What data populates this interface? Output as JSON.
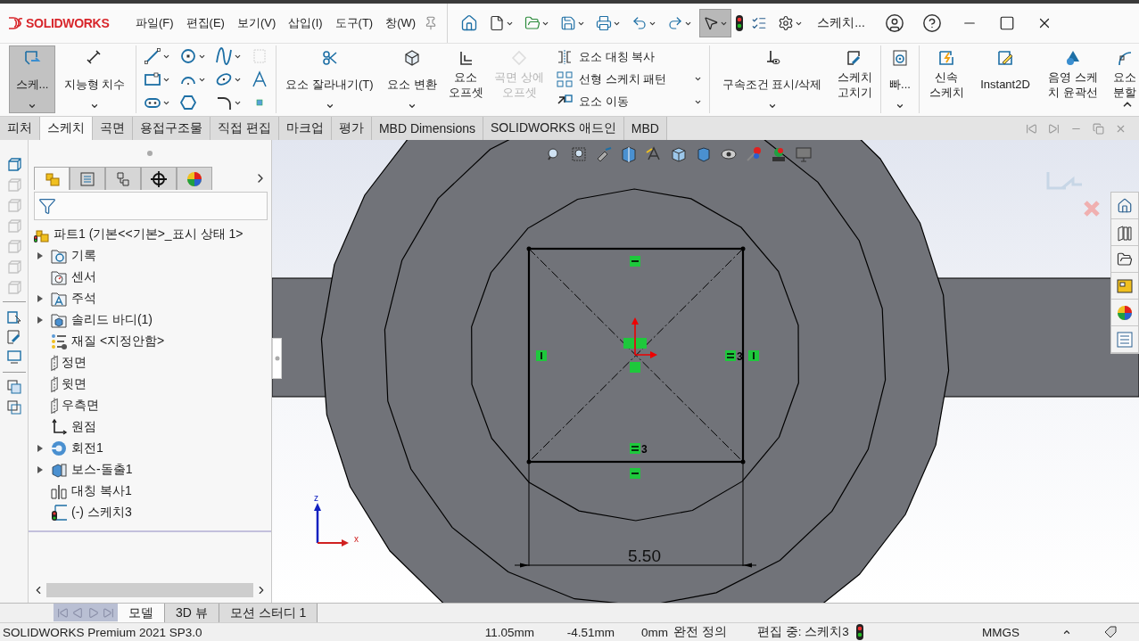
{
  "titlebar": {
    "logo": "SOLIDWORKS",
    "menu": [
      "파일(F)",
      "편집(E)",
      "보기(V)",
      "삽입(I)",
      "도구(T)",
      "창(W)"
    ],
    "search": "스케치..."
  },
  "ribbon": {
    "sections": [
      {
        "items": [
          {
            "kind": "button",
            "label": "스케...",
            "selected": true,
            "disabled": false,
            "dropdown": true
          },
          {
            "kind": "button",
            "label": "지능형 치수",
            "selected": false,
            "disabled": false,
            "dropdown": true
          }
        ]
      },
      {
        "items": [
          {
            "kind": "tool-grid",
            "tools": [
              {
                "dropdown": true,
                "disabled": false
              },
              {
                "dropdown": true,
                "disabled": false
              },
              {
                "dropdown": true,
                "disabled": false
              },
              {
                "dropdown": false,
                "disabled": true
              },
              {
                "dropdown": true,
                "disabled": false
              },
              {
                "dropdown": true,
                "disabled": false
              },
              {
                "dropdown": true,
                "disabled": false
              },
              {
                "dropdown": false,
                "disabled": false
              },
              {
                "dropdown": true,
                "disabled": false
              },
              {
                "dropdown": false,
                "disabled": false
              },
              {
                "dropdown": true,
                "disabled": false
              },
              {
                "dropdown": false,
                "disabled": false
              }
            ]
          }
        ]
      },
      {
        "items": [
          {
            "kind": "button",
            "label": "요소 잘라내기(T)",
            "selected": false,
            "disabled": false,
            "dropdown": true
          },
          {
            "kind": "button",
            "label": "요소 변환",
            "selected": false,
            "disabled": false,
            "dropdown": true
          },
          {
            "kind": "button",
            "label": "요소 오프셋",
            "selected": false,
            "disabled": false,
            "dropdown": false
          },
          {
            "kind": "button",
            "label": "곡면 상에 오프셋",
            "selected": false,
            "disabled": true,
            "dropdown": false
          },
          {
            "kind": "stack",
            "rows": [
              {
                "label": "요소 대칭 복사",
                "dropdown": false
              },
              {
                "label": "선형 스케치 패턴",
                "dropdown": true
              },
              {
                "label": "요소 이동",
                "dropdown": true
              }
            ]
          }
        ]
      },
      {
        "items": [
          {
            "kind": "button",
            "label": "구속조건 표시/삭제",
            "selected": false,
            "disabled": false,
            "dropdown": true
          },
          {
            "kind": "button",
            "label": "스케치 고치기",
            "selected": false,
            "disabled": false,
            "dropdown": false
          }
        ]
      },
      {
        "items": [
          {
            "kind": "button",
            "label": "빠...",
            "selected": false,
            "disabled": false,
            "dropdown": true
          }
        ]
      },
      {
        "items": [
          {
            "kind": "button",
            "label": "신속 스케치",
            "selected": false,
            "disabled": false,
            "dropdown": false
          },
          {
            "kind": "button",
            "label": "Instant2D",
            "selected": false,
            "disabled": false,
            "dropdown": false
          },
          {
            "kind": "button",
            "label": "음영 스케치 윤곽선",
            "selected": false,
            "disabled": false,
            "dropdown": false
          },
          {
            "kind": "button",
            "label": "요소 분할",
            "selected": false,
            "disabled": false,
            "dropdown": false
          }
        ]
      }
    ]
  },
  "command_tabs": [
    {
      "label": "피처",
      "selected": false
    },
    {
      "label": "스케치",
      "selected": true
    },
    {
      "label": "곡면",
      "selected": false
    },
    {
      "label": "용접구조물",
      "selected": false
    },
    {
      "label": "직접 편집",
      "selected": false
    },
    {
      "label": "마크업",
      "selected": false
    },
    {
      "label": "평가",
      "selected": false
    },
    {
      "label": "MBD Dimensions",
      "selected": false
    },
    {
      "label": "SOLIDWORKS 애드인",
      "selected": false
    },
    {
      "label": "MBD",
      "selected": false
    }
  ],
  "manager_tabs": [
    {
      "selected": true
    },
    {
      "selected": false
    },
    {
      "selected": false
    },
    {
      "selected": false
    },
    {
      "selected": false
    }
  ],
  "tree": {
    "root": {
      "label": "파트1  (기본<<기본>_표시 상태 1>",
      "kind": "part"
    },
    "items": [
      {
        "label": "기록",
        "kind": "history",
        "expandable": true
      },
      {
        "label": "센서",
        "kind": "sensor",
        "expandable": false
      },
      {
        "label": "주석",
        "kind": "annotation",
        "expandable": true
      },
      {
        "label": "솔리드 바디(1)",
        "kind": "body",
        "expandable": true
      },
      {
        "label": "재질 <지정안함>",
        "kind": "material",
        "expandable": false
      },
      {
        "label": "정면",
        "kind": "plane",
        "expandable": false
      },
      {
        "label": "윗면",
        "kind": "plane",
        "expandable": false
      },
      {
        "label": "우측면",
        "kind": "plane",
        "expandable": false
      },
      {
        "label": "원점",
        "kind": "origin",
        "expandable": false
      },
      {
        "label": "회전1",
        "kind": "revolve",
        "expandable": true
      },
      {
        "label": "보스-돌출1",
        "kind": "extrude",
        "expandable": true
      },
      {
        "label": "대칭 복사1",
        "kind": "mirror",
        "expandable": false
      },
      {
        "label": "(-) 스케치3",
        "kind": "sketch",
        "expandable": false
      }
    ]
  },
  "viewport": {
    "dimension": "5.50",
    "relation_counts": [
      "3",
      "3"
    ],
    "axes": [
      "z",
      "x"
    ]
  },
  "bottom_tabs": [
    {
      "label": "모델",
      "selected": true
    },
    {
      "label": "3D 뷰",
      "selected": false
    },
    {
      "label": "모션 스터디 1",
      "selected": false
    }
  ],
  "status_bar": {
    "product": "SOLIDWORKS Premium 2021 SP3.0",
    "x": "11.05mm",
    "y": "-4.51mm",
    "z": "0mm",
    "state": "완전 정의",
    "editing": "편집 중: 스케치3",
    "units": "MMGS"
  }
}
